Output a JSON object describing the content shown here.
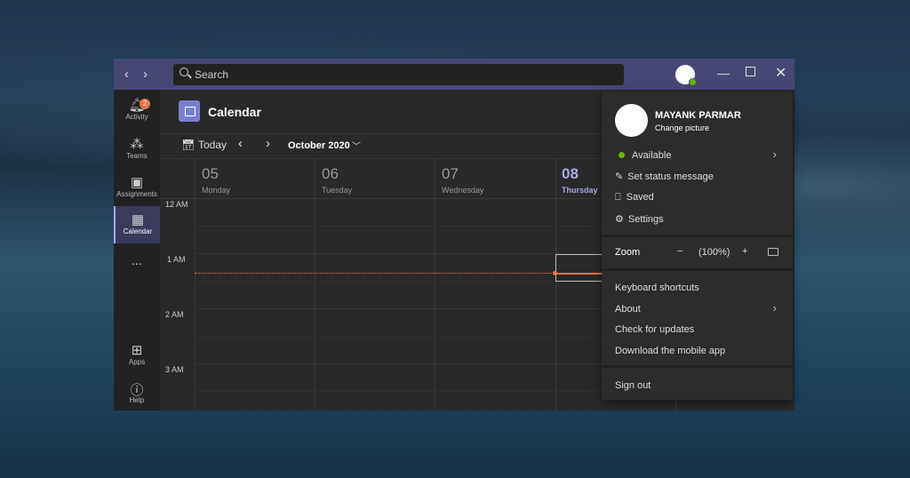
{
  "titlebar": {
    "search_placeholder": "Search"
  },
  "sidebar": {
    "items": [
      {
        "label": "Activity",
        "badge": "2"
      },
      {
        "label": "Teams"
      },
      {
        "label": "Assignments"
      },
      {
        "label": "Calendar"
      },
      {
        "label": "..."
      },
      {
        "label": "Apps"
      },
      {
        "label": "Help"
      }
    ]
  },
  "calendar": {
    "title": "Calendar",
    "today": "Today",
    "month": "October 2020",
    "days": [
      {
        "num": "05",
        "name": "Monday"
      },
      {
        "num": "06",
        "name": "Tuesday"
      },
      {
        "num": "07",
        "name": "Wednesday"
      },
      {
        "num": "08",
        "name": "Thursday"
      }
    ],
    "hours": [
      "12 AM",
      "1 AM",
      "2 AM",
      "3 AM"
    ]
  },
  "profile_menu": {
    "name": "MAYANK PARMAR",
    "change_picture": "Change picture",
    "status": "Available",
    "set_status": "Set status message",
    "saved": "Saved",
    "settings": "Settings",
    "zoom_label": "Zoom",
    "zoom_minus": "−",
    "zoom_value": "(100%)",
    "zoom_plus": "+",
    "keyboard": "Keyboard shortcuts",
    "about": "About",
    "updates": "Check for updates",
    "mobile": "Download the mobile app",
    "sign_out": "Sign out"
  },
  "colors": {
    "accent": "#7b7fd0",
    "titlebar": "#474776",
    "available": "#6bb700",
    "badge": "#e97548",
    "now_line": "#e97548"
  }
}
